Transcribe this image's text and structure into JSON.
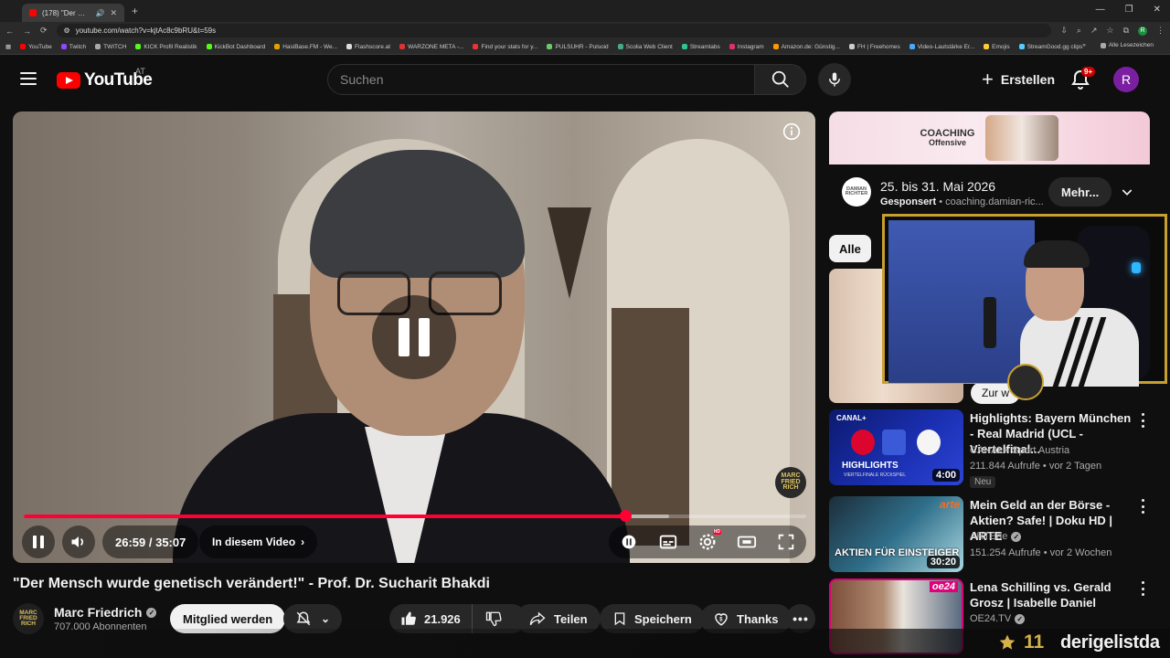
{
  "browser": {
    "tab_title": "(178) \"Der Mensch wurde g",
    "url": "youtube.com/watch?v=kjtAc8c9bRU&t=59s",
    "bookmarks": [
      "YouTube",
      "Twitch",
      "TWITCH",
      "KICK Profil Realistik",
      "KickBot Dashboard",
      "HasiBase.FM - We...",
      "Flashscore.at",
      "WARZONE META -...",
      "Find your stats for y...",
      "PULSUHR - Pulsoid",
      "Scolia Web Client",
      "Streamlabs",
      "Instagram",
      "Amazon.de: Günstig...",
      "FH | Freehomes",
      "Video-Lautstärke Er...",
      "Emojis",
      "StreamGood.gg clips"
    ],
    "bookmarks_other": "Alle Lesezeichen",
    "profile_initial": "R"
  },
  "header": {
    "logo_text": "YouTube",
    "country_code": "AT",
    "search_placeholder": "Suchen",
    "create_label": "Erstellen",
    "notification_count": "9+",
    "avatar_initial": "R"
  },
  "player": {
    "time_display": "26:59 / 35:07",
    "chapter_label": "In diesem Video",
    "watermark_text": "MARC FRIED RICH",
    "hd_label": "HD",
    "progress_fraction": 0.7685,
    "buffer_fraction": 0.825
  },
  "video": {
    "title": "\"Der Mensch wurde genetisch verändert!\" - Prof. Dr. Sucharit Bhakdi",
    "channel_name": "Marc Friedrich",
    "subscribers": "707.000 Abonnenten",
    "join_label": "Mitglied werden",
    "like_count": "21.926",
    "share_label": "Teilen",
    "save_label": "Speichern",
    "thanks_label": "Thanks",
    "channel_avatar_text": "MARC FRIED RICH"
  },
  "ad": {
    "banner_brand_top": "COACHING",
    "banner_brand_sub": "Offensive",
    "logo_text": "DAMIAN RICHTER",
    "title": "25. bis 31. Mai 2026",
    "sponsored_label": "Gesponsert",
    "sponsor_domain": "coaching.damian-ric...",
    "more_label": "Mehr..."
  },
  "chips": {
    "all_label": "Alle"
  },
  "overlay": {
    "zur_label": "Zur w",
    "star_count": "11",
    "viewer_name": "derigelistda"
  },
  "recommendations": [
    {
      "title": "Highlights: Bayern München - Real Madrid (UCL - Viertelfinal...",
      "channel": "CANAL+ Sport Austria",
      "meta": "211.844 Aufrufe • vor 2 Tagen",
      "badge": "Neu",
      "duration": "4:00",
      "thumb_brand": "CANAL+",
      "thumb_headline": "HIGHLIGHTS",
      "thumb_sub": "VIERTELFINALE RÜCKSPIEL"
    },
    {
      "title": "Mein Geld an der Börse - Aktien? Safe! | Doku HD | ARTE",
      "channel": "ARTEde",
      "meta": "151.254 Aufrufe • vor 2 Wochen",
      "duration": "30:20",
      "thumb_brand": "arte",
      "thumb_headline": "AKTIEN FÜR EINSTEIGER"
    },
    {
      "title": "Lena Schilling vs. Gerald Grosz | Isabelle Daniel",
      "channel": "OE24.TV",
      "thumb_brand": "oe24"
    }
  ]
}
